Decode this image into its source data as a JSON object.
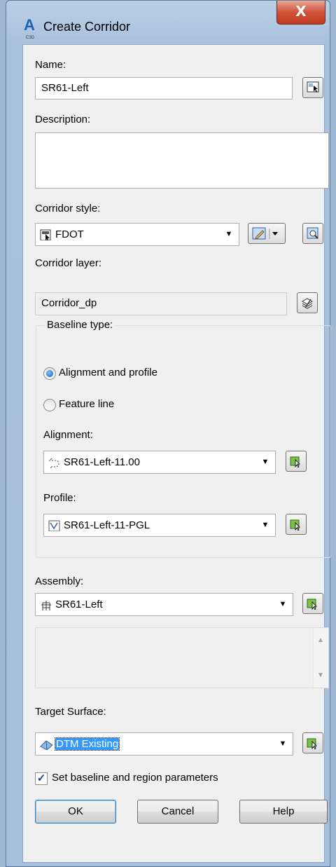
{
  "window": {
    "title": "Create Corridor",
    "app_icon_letter": "A",
    "close_glyph": "X"
  },
  "name": {
    "label": "Name:",
    "value": "SR61-Left"
  },
  "description": {
    "label": "Description:",
    "value": ""
  },
  "corridor_style": {
    "label": "Corridor style:",
    "value": "FDOT"
  },
  "corridor_layer": {
    "label": "Corridor layer:",
    "value": "Corridor_dp"
  },
  "baseline_type": {
    "label": "Baseline type:",
    "options": [
      "Alignment and profile",
      "Feature line"
    ],
    "selected": "Alignment and profile"
  },
  "alignment": {
    "label": "Alignment:",
    "value": "SR61-Left-11.00"
  },
  "profile": {
    "label": "Profile:",
    "value": "SR61-Left-11-PGL"
  },
  "assembly": {
    "label": "Assembly:",
    "value": "SR61-Left"
  },
  "target_surface": {
    "label": "Target Surface:",
    "value": "DTM Existing"
  },
  "set_baseline": {
    "label": "Set baseline and region parameters",
    "checked": true
  },
  "buttons": {
    "ok": "OK",
    "cancel": "Cancel",
    "help": "Help"
  },
  "colors": {
    "accent": "#3399ff",
    "title_bar": "#b9cfe6",
    "close": "#c03a1f"
  }
}
